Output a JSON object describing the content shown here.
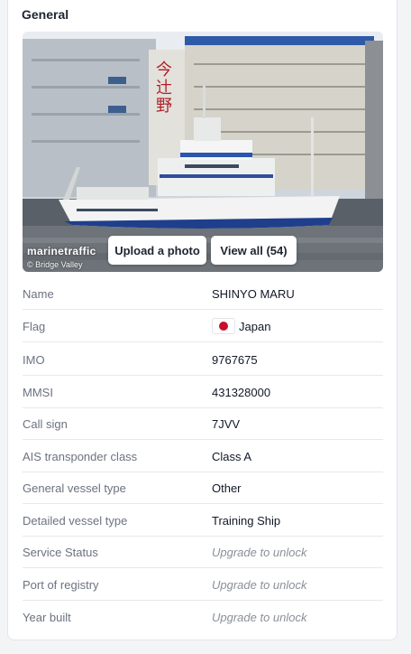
{
  "section": {
    "title": "General"
  },
  "photo": {
    "watermark": "marinetraffic",
    "credit": "© Bridge Valley",
    "upload_label": "Upload a photo",
    "view_all_label": "View all (54)",
    "image_description_icon": "ship-photo"
  },
  "details": [
    {
      "label": "Name",
      "value": "SHINYO MARU"
    },
    {
      "label": "Flag",
      "value": "Japan",
      "flag_icon": "japan-flag-icon"
    },
    {
      "label": "IMO",
      "value": "9767675"
    },
    {
      "label": "MMSI",
      "value": "431328000"
    },
    {
      "label": "Call sign",
      "value": "7JVV"
    },
    {
      "label": "AIS transponder class",
      "value": "Class A"
    },
    {
      "label": "General vessel type",
      "value": "Other"
    },
    {
      "label": "Detailed vessel type",
      "value": "Training Ship"
    },
    {
      "label": "Service Status",
      "value": "Upgrade to unlock",
      "locked": true
    },
    {
      "label": "Port of registry",
      "value": "Upgrade to unlock",
      "locked": true
    },
    {
      "label": "Year built",
      "value": "Upgrade to unlock",
      "locked": true
    }
  ],
  "colors": {
    "card_bg": "#ffffff",
    "label": "#6b7280",
    "value": "#111827",
    "locked": "#8a8f99",
    "flag_red": "#c8102e"
  }
}
